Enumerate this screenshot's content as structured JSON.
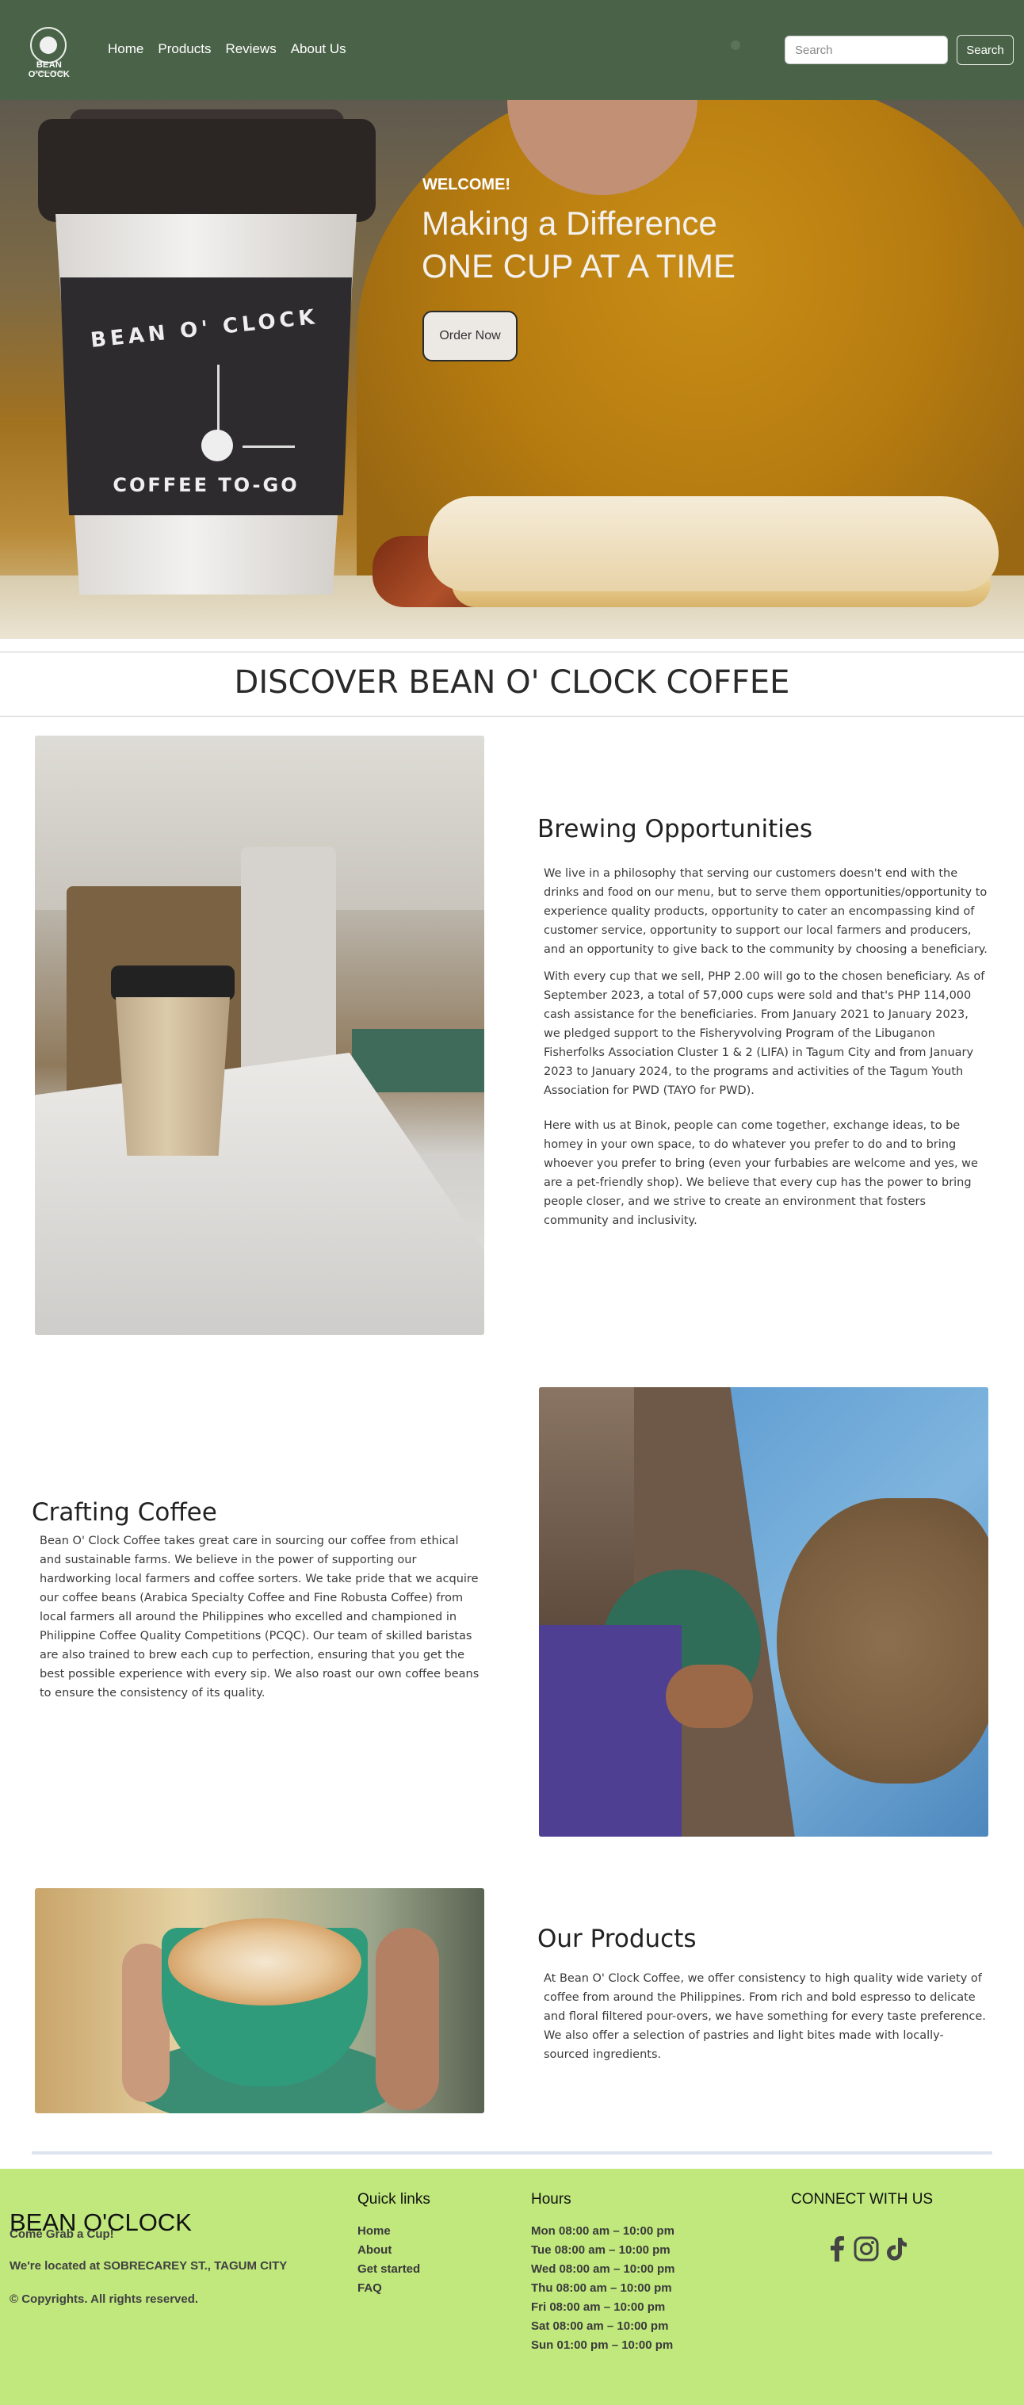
{
  "nav": {
    "logo_brand": "BEAN O'CLOCK",
    "logo_sub": "COFFEE TO-GO",
    "links": [
      "Home",
      "Products",
      "Reviews",
      "About Us"
    ],
    "search_placeholder": "Search",
    "search_button": "Search"
  },
  "hero": {
    "welcome": "WELCOME!",
    "line1": "Making a Difference",
    "line2": "ONE CUP AT A TIME",
    "order_button": "Order Now",
    "cup_sleeve_top": "BEAN O' CLOCK",
    "cup_sleeve_bottom": "COFFEE TO-GO"
  },
  "discover": {
    "title": "DISCOVER BEAN O' CLOCK COFFEE"
  },
  "brewing": {
    "title": "Brewing Opportunities",
    "paragraphs": [
      "We live in a philosophy that serving our customers doesn't end with the drinks and food on our menu, but to serve them opportunities/opportunity to experience quality products, opportunity to cater an encompassing kind of customer service, opportunity to support our local farmers and producers, and an opportunity to give back to the community by choosing a beneficiary.",
      "With every cup that we sell, PHP 2.00 will go to the chosen beneficiary. As of September 2023, a total of 57,000 cups were sold and that's PHP 114,000 cash assistance for the beneficiaries. From January 2021 to January 2023, we pledged support to the Fisheryvolving Program of the Libuganon Fisherfolks Association Cluster 1 & 2 (LIFA) in Tagum City and from January 2023 to January 2024, to the programs and activities of the Tagum Youth Association for PWD (TAYO for PWD).",
      "Here with us at Binok, people can come together, exchange ideas, to be homey in your own space, to do whatever you prefer to do and to bring whoever you prefer to bring (even your furbabies are welcome and yes, we are a pet-friendly shop). We believe that every cup has the power to bring people closer, and we strive to create an environment that fosters community and inclusivity."
    ]
  },
  "crafting": {
    "title": "Crafting Coffee",
    "paragraph": "Bean O' Clock Coffee takes great care in sourcing our coffee from ethical and sustainable farms. We believe in the power of supporting our hardworking local farmers and coffee sorters. We take pride that we acquire our coffee beans (Arabica Specialty Coffee and Fine Robusta Coffee) from local farmers all around the Philippines who excelled and championed in Philippine Coffee Quality Competitions (PCQC). Our team of skilled baristas are also trained to brew each cup to perfection, ensuring that you get the best possible experience with every sip. We also roast our own coffee beans to ensure the consistency of its quality."
  },
  "products": {
    "title": "Our Products",
    "paragraph": "At Bean O' Clock Coffee, we offer consistency to high quality wide variety of coffee from around the Philippines. From rich and bold espresso to delicate and floral filtered pour-overs, we have something for every taste preference. We also offer a selection of pastries and light bites made with locally-sourced ingredients."
  },
  "footer": {
    "brand": "BEAN O'CLOCK",
    "tagline": "Come Grab a Cup!",
    "location": "We're located at SOBRECAREY ST., TAGUM CITY",
    "copyright": "© Copyrights. All rights reserved.",
    "quick_links_title": "Quick links",
    "quick_links": [
      "Home",
      "About",
      "Get started",
      "FAQ"
    ],
    "hours_title": "Hours",
    "hours": [
      "Mon 08:00 am – 10:00 pm",
      "Tue 08:00 am – 10:00 pm",
      "Wed 08:00 am – 10:00 pm",
      "Thu 08:00 am – 10:00 pm",
      "Fri 08:00 am – 10:00 pm",
      "Sat 08:00 am – 10:00 pm",
      "Sun 01:00 pm – 10:00 pm"
    ],
    "connect_title": "CONNECT WITH US",
    "social_icons": [
      "facebook-icon",
      "instagram-icon",
      "tiktok-icon"
    ]
  },
  "colors": {
    "navbar": "#4a6348",
    "footer": "#c0e87d"
  }
}
